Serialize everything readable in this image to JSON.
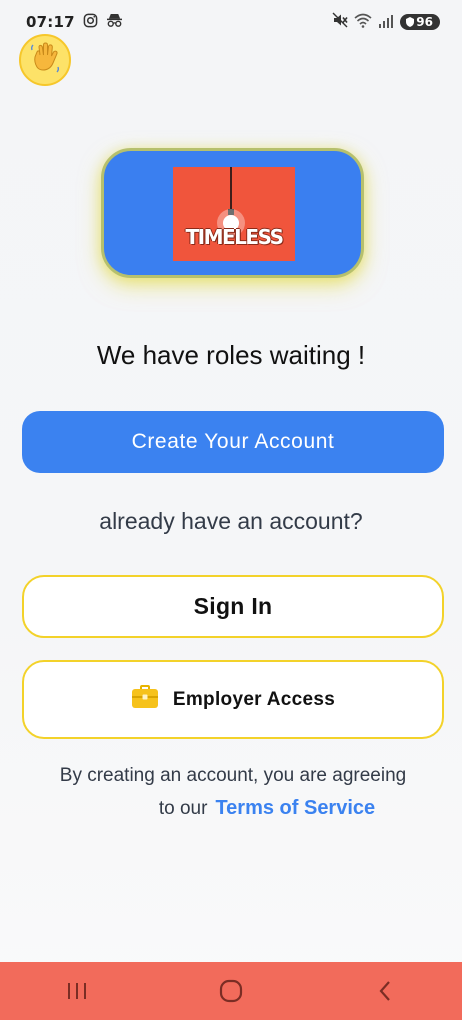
{
  "status_bar": {
    "time": "07:17",
    "battery": "96",
    "left_icons": [
      "instagram-icon",
      "incognito-icon"
    ],
    "right_icons": [
      "mute-icon",
      "wifi-icon",
      "signal-icon",
      "battery-icon"
    ]
  },
  "avatar_icon": "waving-hand-icon",
  "logo": {
    "text": "TIMELESS"
  },
  "headline": "We have roles waiting !",
  "create_account_label": "Create Your Account",
  "already_text": "already have an account?",
  "signin_label": "Sign In",
  "employer": {
    "icon": "briefcase-icon",
    "label": "Employer Access"
  },
  "terms": {
    "line1": "By creating an account, you are agreeing",
    "prefix": "to our",
    "link": "Terms of Service"
  },
  "nav": [
    "recent-apps-icon",
    "home-icon",
    "back-icon"
  ],
  "colors": {
    "primary": "#3b82f0",
    "accent_border": "#f3d22a",
    "nav_bar": "#f26b5b",
    "logo_bg": "#f0553c"
  }
}
